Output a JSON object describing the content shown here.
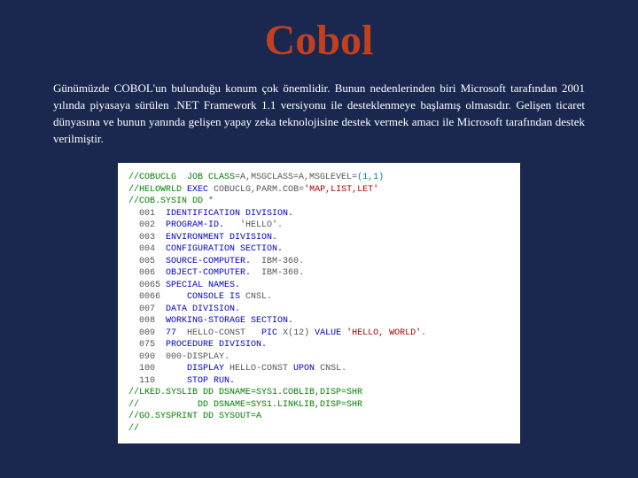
{
  "title": "Cobol",
  "paragraph": "Günümüzde COBOL'un bulunduğu konum çok önemlidir. Bunun nedenlerinden biri Microsoft tarafından 2001 yılında piyasaya sürülen .NET Framework 1.1 versiyonu ile desteklenmeye başlamış olmasıdır. Gelişen ticaret dünyasına ve bunun yanında gelişen yapay zeka teknolojisine destek vermek amacı ile Microsoft tarafından destek verilmiştir.",
  "code": {
    "l01a": "//COBUCLG  JOB CLASS",
    "l01b": "=A,MSGCLASS=A,MSGLEVEL=",
    "l01c": "(1,1)",
    "l02a": "//HELOWRLD ",
    "l02b": "EXEC",
    "l02c": " COBUCLG,PARM.COB=",
    "l02d": "'MAP,LIST,LET'",
    "l03": "//COB.SYSIN DD *",
    "l04a": "  001  ",
    "l04b": "IDENTIFICATION DIVISION.",
    "l05a": "  002  ",
    "l05b": "PROGRAM-ID.",
    "l05c": "   'HELLO'.",
    "l06a": "  003  ",
    "l06b": "ENVIRONMENT DIVISION.",
    "l07a": "  004  ",
    "l07b": "CONFIGURATION SECTION.",
    "l08a": "  005  ",
    "l08b": "SOURCE-COMPUTER.",
    "l08c": "  IBM-360.",
    "l09a": "  006  ",
    "l09b": "OBJECT-COMPUTER.",
    "l09c": "  IBM-360.",
    "l10a": "  0065 ",
    "l10b": "SPECIAL NAMES.",
    "l11a": "  0066     ",
    "l11b": "CONSOLE IS",
    "l11c": " CNSL.",
    "l12a": "  007  ",
    "l12b": "DATA DIVISION.",
    "l13a": "  008  ",
    "l13b": "WORKING-STORAGE SECTION.",
    "l14a": "  009  ",
    "l14b": "77",
    "l14c": "  HELLO-CONST   ",
    "l14d": "PIC",
    "l14e": " X(12) ",
    "l14f": "VALUE",
    "l14g": " ",
    "l14h": "'HELLO, WORLD'",
    "l14i": ".",
    "l15a": "  075  ",
    "l15b": "PROCEDURE DIVISION.",
    "l16a": "  090  ",
    "l16b": "000-DISPLAY.",
    "l17a": "  100      ",
    "l17b": "DISPLAY",
    "l17c": " HELLO-CONST ",
    "l17d": "UPON",
    "l17e": " CNSL.",
    "l18a": "  110      ",
    "l18b": "STOP RUN.",
    "l19": "//LKED.SYSLIB DD DSNAME=SYS1.COBLIB,DISP=SHR",
    "l20": "//           DD DSNAME=SYS1.LINKLIB,DISP=SHR",
    "l21": "//GO.SYSPRINT DD SYSOUT=A",
    "l22": "//"
  }
}
